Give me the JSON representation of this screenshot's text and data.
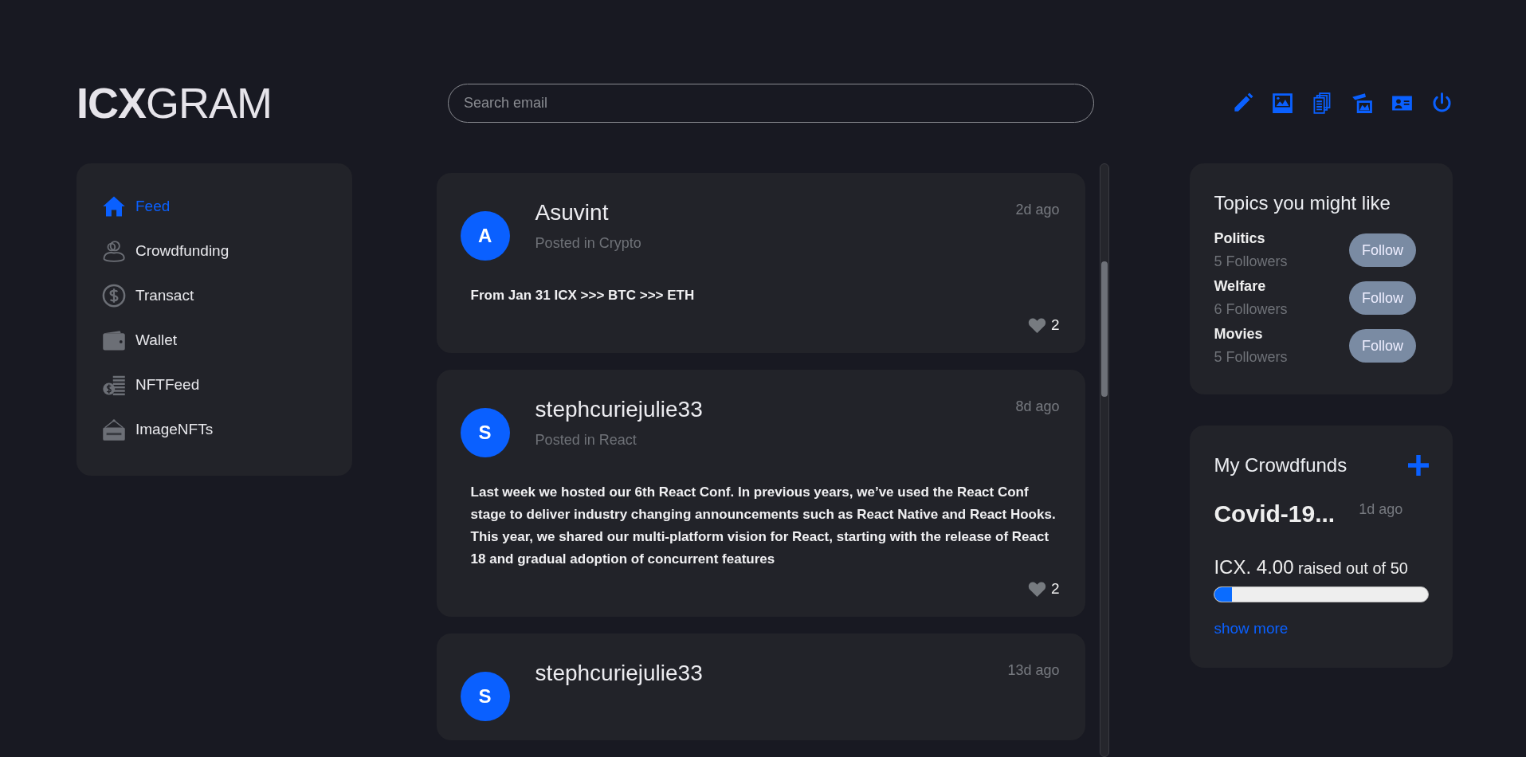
{
  "logo": {
    "bold": "ICX",
    "light": "GRAM"
  },
  "search": {
    "placeholder": "Search email"
  },
  "sidebar": {
    "items": [
      {
        "label": "Feed",
        "selected": true
      },
      {
        "label": "Crowdfunding",
        "selected": false
      },
      {
        "label": "Transact",
        "selected": false
      },
      {
        "label": "Wallet",
        "selected": false
      },
      {
        "label": "NFTFeed",
        "selected": false
      },
      {
        "label": "ImageNFTs",
        "selected": false
      }
    ]
  },
  "feed": {
    "posts": [
      {
        "avatar": "A",
        "author": "Asuvint",
        "category": "Posted in Crypto",
        "time": "2d ago",
        "text": "From Jan 31 ICX >>> BTC >>> ETH",
        "likes": "2"
      },
      {
        "avatar": "S",
        "author": "stephcuriejulie33",
        "category": "Posted in React",
        "time": "8d ago",
        "text": "Last week we hosted our 6th React Conf. In previous years, we’ve used the React Conf stage to deliver industry changing announcements such as React Native and React Hooks. This year, we shared our multi-platform vision for React, starting with the release of React 18 and gradual adoption of concurrent features",
        "likes": "2"
      },
      {
        "avatar": "S",
        "author": "stephcuriejulie33",
        "time": "13d ago"
      }
    ]
  },
  "topics": {
    "title": "Topics you might like",
    "items": [
      {
        "name": "Politics",
        "followers": "5 Followers",
        "button": "Follow"
      },
      {
        "name": "Welfare",
        "followers": "6 Followers",
        "button": "Follow"
      },
      {
        "name": "Movies",
        "followers": "5 Followers",
        "button": "Follow"
      }
    ]
  },
  "crowdfunds": {
    "title": "My Crowdfunds",
    "items": [
      {
        "title": "Covid-19...",
        "time": "1d ago",
        "amount": "ICX. 4.00",
        "raised": "raised out of 50",
        "level": 0.08
      }
    ],
    "link": "show more"
  }
}
